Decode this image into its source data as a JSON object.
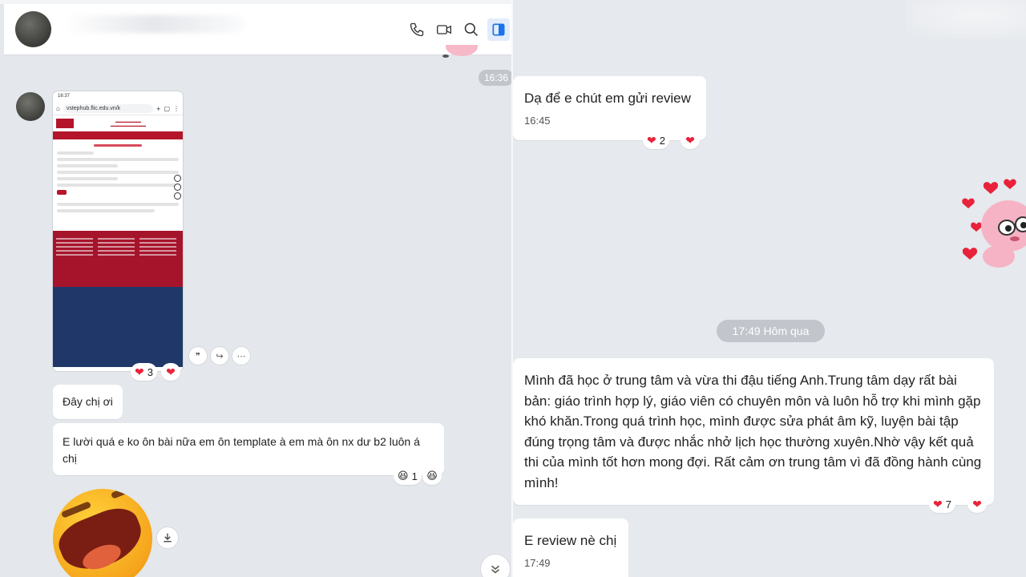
{
  "left_chat": {
    "header": {
      "icons": [
        "phone-icon",
        "video-call-icon",
        "search-icon",
        "sidebar-toggle-icon"
      ]
    },
    "time_divider_top": "16:36",
    "screenshot_message": {
      "status_bar": "16:37",
      "url": "vstephub.flic.edu.vn/k",
      "reaction_count": "3",
      "actions": [
        "quote-icon",
        "forward-icon",
        "more-icon"
      ]
    },
    "messages": [
      {
        "text": "Đây chị ơi"
      },
      {
        "text": "E lười quá e ko ôn bài nữa em ôn template à em mà ôn nx dư b2 luôn á chị",
        "reaction_count": "1"
      }
    ]
  },
  "right_chat": {
    "messages": [
      {
        "text": "Dạ để e chút em gửi review",
        "time": "16:45",
        "reaction_count": "2"
      },
      {
        "text": "Mình đã học ở trung tâm và vừa thi đậu tiếng Anh.Trung tâm dạy rất bài bản: giáo trình hợp lý, giáo viên có chuyên môn và luôn hỗ trợ khi mình gặp khó khăn.Trong quá trình học, mình được sửa phát âm kỹ, luyện bài tập đúng trọng tâm và được nhắc nhở lịch học thường xuyên.Nhờ vậy kết quả thi của mình tốt hơn mong đợi. Rất cảm ơn trung tâm vì đã đồng hành cùng mình!",
        "reaction_count": "7"
      },
      {
        "text": "E review nè chị",
        "time": "17:49"
      }
    ],
    "time_divider": "17:49 Hôm qua"
  },
  "colors": {
    "heart": "#e8223b",
    "accent": "#1a73e8",
    "time_pill": "#c2c6cc"
  }
}
